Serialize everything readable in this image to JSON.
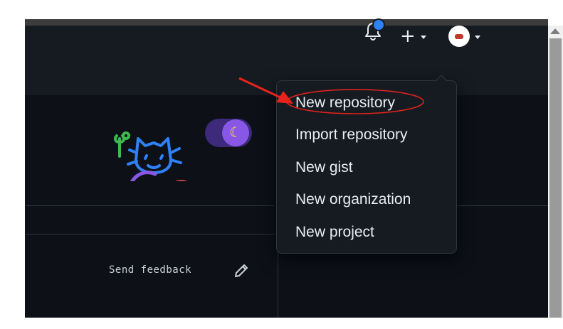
{
  "header": {
    "notification_dot_color": "#2f81f7",
    "create_button_icon": "plus-icon",
    "avatar_icon": "avatar-icon"
  },
  "create_menu": {
    "items": [
      {
        "label": "New repository"
      },
      {
        "label": "Import repository"
      },
      {
        "label": "New gist"
      },
      {
        "label": "New organization"
      },
      {
        "label": "New project"
      }
    ]
  },
  "footer": {
    "send_feedback_label": "Send feedback"
  },
  "illustration": {
    "toggle_icon": "moon-icon"
  },
  "colors": {
    "background": "#0d1117",
    "header_bg": "#161b22",
    "menu_bg": "#161b22",
    "text": "#e6edf3",
    "annotation_red": "#e8231b"
  }
}
